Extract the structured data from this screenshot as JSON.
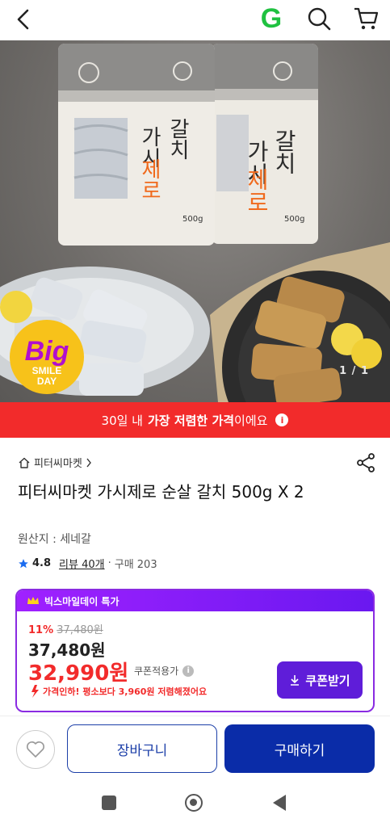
{
  "topbar": {
    "logo_letter": "G",
    "colors": {
      "logo": "#1fc140"
    }
  },
  "hero": {
    "pager": "1 / 1",
    "package": {
      "brand_a": "갈치",
      "brand_b": "가시",
      "brand_c": "제로",
      "weight": "500g"
    },
    "badge": {
      "big": "Big",
      "smile": "SMILE",
      "day": "DAY"
    }
  },
  "banner": {
    "prefix": "30일 내",
    "emphasis": "가장 저렴한 가격",
    "suffix": "이에요",
    "info_icon": "i",
    "color": "#f22b2b"
  },
  "product": {
    "store": "피터씨마켓",
    "title": "피터씨마켓 가시제로 순살 갈치 500g X 2",
    "origin": "원산지 : 세네갈",
    "rating": "4.8",
    "reviews": "리뷰 40개",
    "sep": "·",
    "purchases": "구매 203"
  },
  "pricebox": {
    "header": "빅스마일데이 특가",
    "discount_rate": "11%",
    "original_price": "37,480원",
    "price": "37,480원",
    "coupon_price": "32,990원",
    "coupon_label": "쿠폰적용가",
    "coupon_button": "쿠폰받기",
    "drop_text": "가격인하! 평소보다 3,960원 저렴해졌어요",
    "colors": {
      "accent": "#8a2be2",
      "button": "#5f1dd9",
      "red": "#f22b2b"
    }
  },
  "actions": {
    "cart": "장바구니",
    "buy": "구매하기",
    "colors": {
      "primary": "#0a2ca8"
    }
  }
}
